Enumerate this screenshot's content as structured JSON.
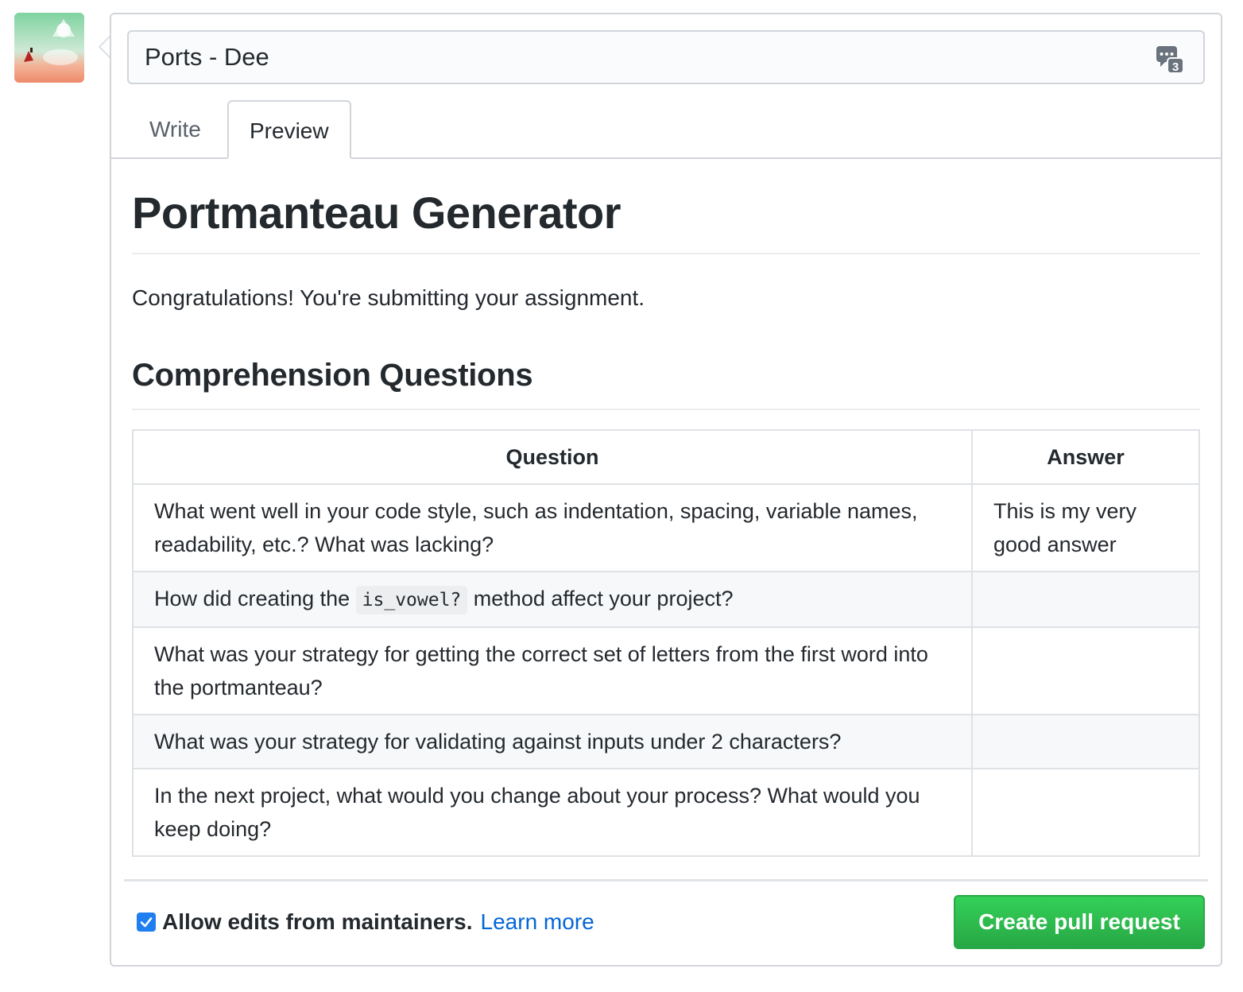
{
  "title_input": {
    "value": "Ports - Dee",
    "saved_replies_count": "3"
  },
  "tabs": [
    {
      "label": "Write",
      "selected": false
    },
    {
      "label": "Preview",
      "selected": true
    }
  ],
  "preview": {
    "heading": "Portmanteau Generator",
    "intro": "Congratulations! You're submitting your assignment.",
    "section_heading": "Comprehension Questions",
    "table": {
      "headers": [
        "Question",
        "Answer"
      ],
      "rows": [
        {
          "question": "What went well in your code style, such as indentation, spacing, variable names, readability, etc.? What was lacking?",
          "answer": "This is my very good answer"
        },
        {
          "question_before": "How did creating the",
          "question_code": "is_vowel?",
          "question_after": "method affect your project?",
          "answer": ""
        },
        {
          "question": "What was your strategy for getting the correct set of letters from the first word into the portmanteau?",
          "answer": ""
        },
        {
          "question": "What was your strategy for validating against inputs under 2 characters?",
          "answer": ""
        },
        {
          "question": "In the next project, what would you change about your process? What would you keep doing?",
          "answer": ""
        }
      ]
    }
  },
  "footer": {
    "allow_edits_label": "Allow edits from maintainers.",
    "allow_edits_checked": true,
    "learn_more": "Learn more",
    "create_button": "Create pull request"
  },
  "colors": {
    "link": "#0366d6",
    "primary_button": "#28a745",
    "checkbox": "#1f7ff0"
  }
}
